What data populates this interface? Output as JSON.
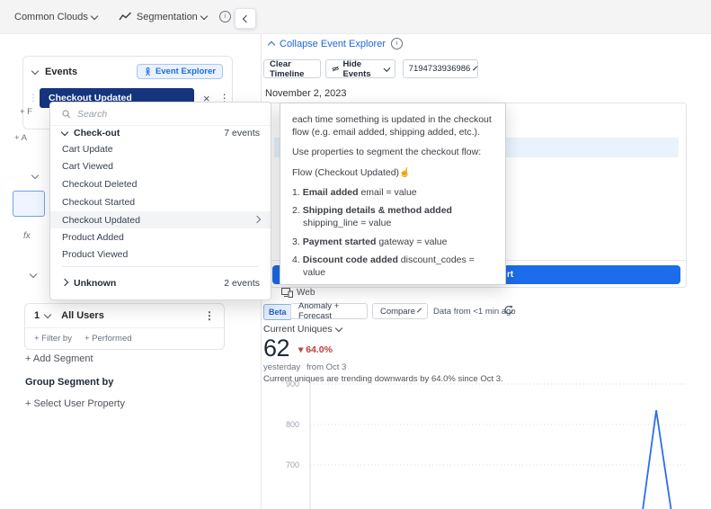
{
  "topbar": {
    "project": "Common Clouds",
    "view": "Segmentation"
  },
  "icons": {
    "info": "i",
    "drag_handle": "⋮⋮",
    "close": "×",
    "kebab": "⋮",
    "down_triangle": "▾",
    "cursor": "☝",
    "fx": "fx"
  },
  "events_panel": {
    "title": "Events",
    "explorer_button": "Event Explorer",
    "selected_event": "Checkout Updated",
    "filter_fragment": "+ F",
    "add_fragment": "+ A"
  },
  "dropdown": {
    "search_placeholder": "Search",
    "group_label": "Check-out",
    "group_count": "7 events",
    "items": [
      "Cart Update",
      "Cart Viewed",
      "Checkout Deleted",
      "Checkout Started",
      "Checkout Updated",
      "Product Added",
      "Product Viewed"
    ],
    "highlighted_item": "Checkout Updated",
    "unknown_label": "Unknown",
    "unknown_count": "2 events"
  },
  "segments": {
    "index": "1",
    "name": "All Users",
    "filter_by": "+ Filter by",
    "performed": "+ Performed",
    "add_segment": "+ Add Segment",
    "group_by_label": "Group Segment by",
    "select_property": "+ Select User Property"
  },
  "explorer": {
    "collapse_label": "Collapse Event Explorer",
    "clear_timeline": "Clear Timeline",
    "hide_events": "Hide Events",
    "user_id": "7194733936986",
    "date": "November 2, 2023",
    "chart_button_fragment": "rt",
    "web_label": "Web"
  },
  "popover": {
    "para1": "each time something is updated in the checkout flow (e.g. email added, shipping added, etc.).",
    "para2": "Use properties to segment the checkout flow:",
    "para3": "Flow (Checkout Updated)",
    "steps": [
      {
        "num": "1.",
        "bold": "Email added",
        "rest": "email = value"
      },
      {
        "num": "2.",
        "bold": "Shipping details & method added",
        "rest": "shipping_line = value"
      },
      {
        "num": "3.",
        "bold": "Payment started",
        "rest": "gateway = value"
      },
      {
        "num": "4.",
        "bold": "Discount code added",
        "rest": "discount_codes = value"
      }
    ]
  },
  "chart_toolbar": {
    "beta": "Beta",
    "anomaly": "Anomaly + Forecast",
    "compare": "Compare",
    "freshness": "Data from <1 min ago"
  },
  "metrics": {
    "label": "Current Uniques",
    "value": "62",
    "change": "64.0%",
    "period": "yesterday",
    "compare_from": "from Oct 3",
    "trend_text": "Current uniques are trending downwards by 64.0% since Oct 3."
  },
  "colors": {
    "accent_blue": "#1c6ceb",
    "navy_chip": "#15357e",
    "negative_red": "#c43d3b",
    "highlight_row": "#e8f3fd",
    "chart_line": "#2e6de6"
  },
  "chart_data": {
    "type": "line",
    "title": "Current Uniques",
    "xlabel": "",
    "ylabel": "",
    "y_ticks": [
      700,
      800,
      900
    ],
    "ylim_visible": [
      590,
      900
    ],
    "grid": "dotted-horizontal",
    "legend": "none",
    "series": [
      {
        "name": "Current Uniques",
        "color": "#2e6de6",
        "note": "line stays below ~600 (off visible crop) except one sharp spike near the right edge peaking around 835",
        "visible_points": [
          {
            "x_frac": 0.881,
            "y": 588
          },
          {
            "x_frac": 0.917,
            "y": 835
          },
          {
            "x_frac": 0.957,
            "y": 585
          }
        ]
      }
    ]
  }
}
